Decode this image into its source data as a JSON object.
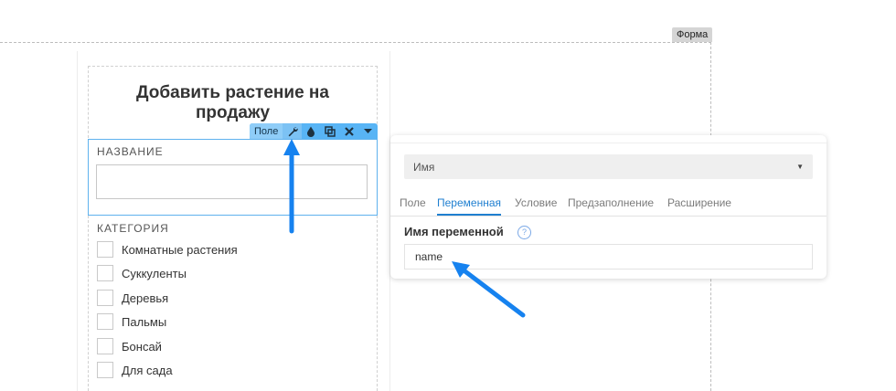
{
  "canvas": {
    "form_tag": "Форма"
  },
  "form": {
    "title": "Добавить растение на продажу",
    "name_field_label": "НАЗВАНИЕ",
    "category_label": "КАТЕГОРИЯ",
    "category_options": [
      "Комнатные растения",
      "Суккуленты",
      "Деревья",
      "Пальмы",
      "Бонсай",
      "Для сада"
    ]
  },
  "field_toolbar": {
    "label": "Поле",
    "icons": [
      "wrench-icon",
      "drop-icon",
      "copy-icon",
      "close-icon",
      "caret-down-icon"
    ]
  },
  "panel": {
    "select_value": "Имя",
    "tabs": [
      "Поле",
      "Переменная",
      "Условие",
      "Предзаполнение",
      "Расширение"
    ],
    "active_tab": "Переменная",
    "variable_name_label": "Имя переменной",
    "variable_name_value": "name"
  },
  "colors": {
    "accent": "#1f7fd0",
    "toolbar": "#58b4f5",
    "arrow": "#1682ef"
  }
}
